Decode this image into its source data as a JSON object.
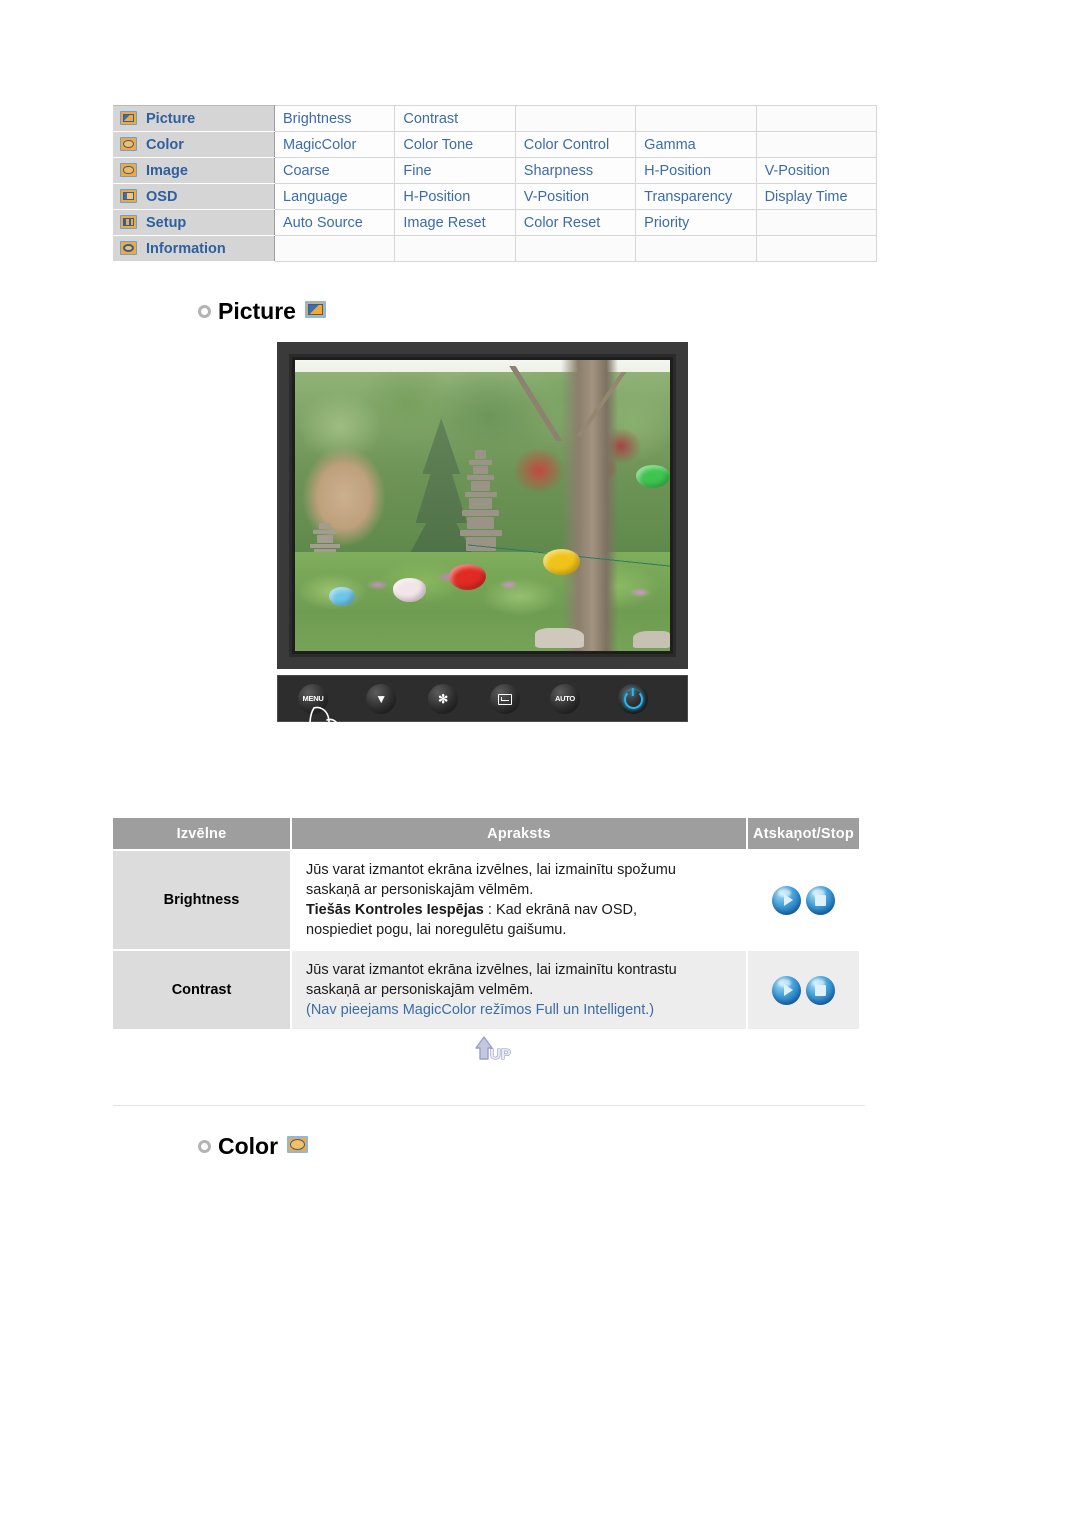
{
  "nav_table": {
    "rows": [
      {
        "icon": "picture-icon",
        "category": "Picture",
        "items": [
          "Brightness",
          "Contrast",
          "",
          "",
          ""
        ]
      },
      {
        "icon": "color-icon",
        "category": "Color",
        "items": [
          "MagicColor",
          "Color Tone",
          "Color Control",
          "Gamma",
          ""
        ]
      },
      {
        "icon": "image-icon",
        "category": "Image",
        "items": [
          "Coarse",
          "Fine",
          "Sharpness",
          "H-Position",
          "V-Position"
        ]
      },
      {
        "icon": "osd-icon",
        "category": "OSD",
        "items": [
          "Language",
          "H-Position",
          "V-Position",
          "Transparency",
          "Display Time"
        ]
      },
      {
        "icon": "setup-icon",
        "category": "Setup",
        "items": [
          "Auto Source",
          "Image Reset",
          "Color Reset",
          "Priority",
          ""
        ]
      },
      {
        "icon": "info-icon",
        "category": "Information",
        "items": [
          "",
          "",
          "",
          "",
          ""
        ]
      }
    ]
  },
  "sections": {
    "picture": {
      "title": "Picture",
      "icon": "picture-icon"
    },
    "color": {
      "title": "Color",
      "icon": "color-icon"
    }
  },
  "monitor": {
    "buttons": [
      {
        "name": "menu-button",
        "label": "MENU"
      },
      {
        "name": "down-up-button",
        "label": "▼"
      },
      {
        "name": "brightness-button",
        "label": "✻"
      },
      {
        "name": "enter-button",
        "label": ""
      },
      {
        "name": "auto-button",
        "label": "AUTO"
      },
      {
        "name": "power-button",
        "label": ""
      }
    ],
    "screen_alt": "Korean garden with stone pagoda, trees and colored paper lanterns"
  },
  "desc_table": {
    "headers": [
      "Izvēlne",
      "Apraksts",
      "Atskaņot/Stop"
    ],
    "rows": [
      {
        "menu": "Brightness",
        "lines": [
          {
            "text": "Jūs varat izmantot ekrāna izvēlnes, lai izmainītu spožumu",
            "style": "normal"
          },
          {
            "text": "saskaņā ar personiskajām vēlmēm.",
            "style": "normal"
          },
          {
            "text": "Tiešās Kontroles Iespējas",
            "style": "bold",
            "suffix": " : Kad ekrānā nav OSD,"
          },
          {
            "text": "nospiediet pogu, lai noregulētu gaišumu.",
            "style": "normal"
          }
        ],
        "controls": [
          "play-orb",
          "stop-orb"
        ]
      },
      {
        "menu": "Contrast",
        "lines": [
          {
            "text": "Jūs varat izmantot ekrāna izvēlnes, lai izmainītu kontrastu",
            "style": "normal"
          },
          {
            "text": "saskaņā ar personiskajām velmēm.",
            "style": "normal"
          },
          {
            "text": "(Nav pieejams MagicColor režīmos Full un Intelligent.)",
            "style": "note"
          }
        ],
        "controls": [
          "play-orb",
          "stop-orb"
        ]
      }
    ]
  },
  "up_button": {
    "label": "UP"
  },
  "colors": {
    "link_blue": "#3c6ca8",
    "header_gray": "#9e9e9e",
    "cat_gray": "#d5d5d5",
    "icon_orange": "#f2a93b",
    "icon_border_blue": "#6f9fd0",
    "power_blue": "#27b6ef"
  }
}
